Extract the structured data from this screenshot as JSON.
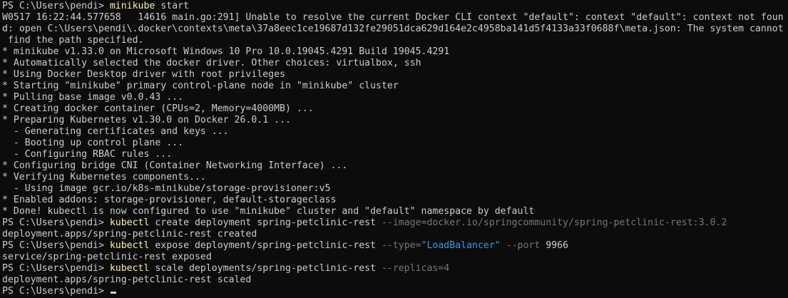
{
  "terminal": {
    "prompt": "PS C:\\Users\\pendi> ",
    "cmd1": {
      "program": "minikube",
      "args": " start"
    },
    "warn_lines": [
      "W0517 16:22:44.577658   14616 main.go:291] Unable to resolve the current Docker CLI context \"default\": context \"default\": context not foun",
      "d: open C:\\Users\\pendi\\.docker\\contexts\\meta\\37a8eec1ce19687d132fe29051dca629d164e2c4958ba141d5f4133a33f0688f\\meta.json: The system cannot",
      " find the path specified."
    ],
    "minikube_output": [
      "* minikube v1.33.0 on Microsoft Windows 10 Pro 10.0.19045.4291 Build 19045.4291",
      "* Automatically selected the docker driver. Other choices: virtualbox, ssh",
      "* Using Docker Desktop driver with root privileges",
      "* Starting \"minikube\" primary control-plane node in \"minikube\" cluster",
      "* Pulling base image v0.0.43 ...",
      "* Creating docker container (CPUs=2, Memory=4000MB) ...",
      "* Preparing Kubernetes v1.30.0 on Docker 26.0.1 ...",
      "  - Generating certificates and keys ...",
      "  - Booting up control plane ...",
      "  - Configuring RBAC rules ...",
      "* Configuring bridge CNI (Container Networking Interface) ...",
      "* Verifying Kubernetes components...",
      "  - Using image gcr.io/k8s-minikube/storage-provisioner:v5",
      "* Enabled addons: storage-provisioner, default-storageclass",
      "* Done! kubectl is now configured to use \"minikube\" cluster and \"default\" namespace by default"
    ],
    "cmd2": {
      "program": "kubectl",
      "args": " create deployment spring-petclinic-rest ",
      "flag": "--image=docker.io/springcommunity/spring-petclinic-rest:3.0.2"
    },
    "out2": "deployment.apps/spring-petclinic-rest created",
    "cmd3": {
      "program": "kubectl",
      "args": " expose deployment/spring-petclinic-rest ",
      "flag1": "--type=",
      "flag1_value": "\"LoadBalancer\"",
      "flag2": " --port ",
      "flag2_value": "9966"
    },
    "out3": "service/spring-petclinic-rest exposed",
    "cmd4": {
      "program": "kubectl",
      "args": " scale deployments/spring-petclinic-rest ",
      "flag": "--replicas=4"
    },
    "out4": "deployment.apps/spring-petclinic-rest scaled",
    "final_prompt": "PS C:\\Users\\pendi> "
  },
  "colors": {
    "background": "#0c0c0c",
    "foreground": "#cccccc",
    "command": "#f9f1a5",
    "parameter": "#767676",
    "string": "#3a96dd"
  }
}
